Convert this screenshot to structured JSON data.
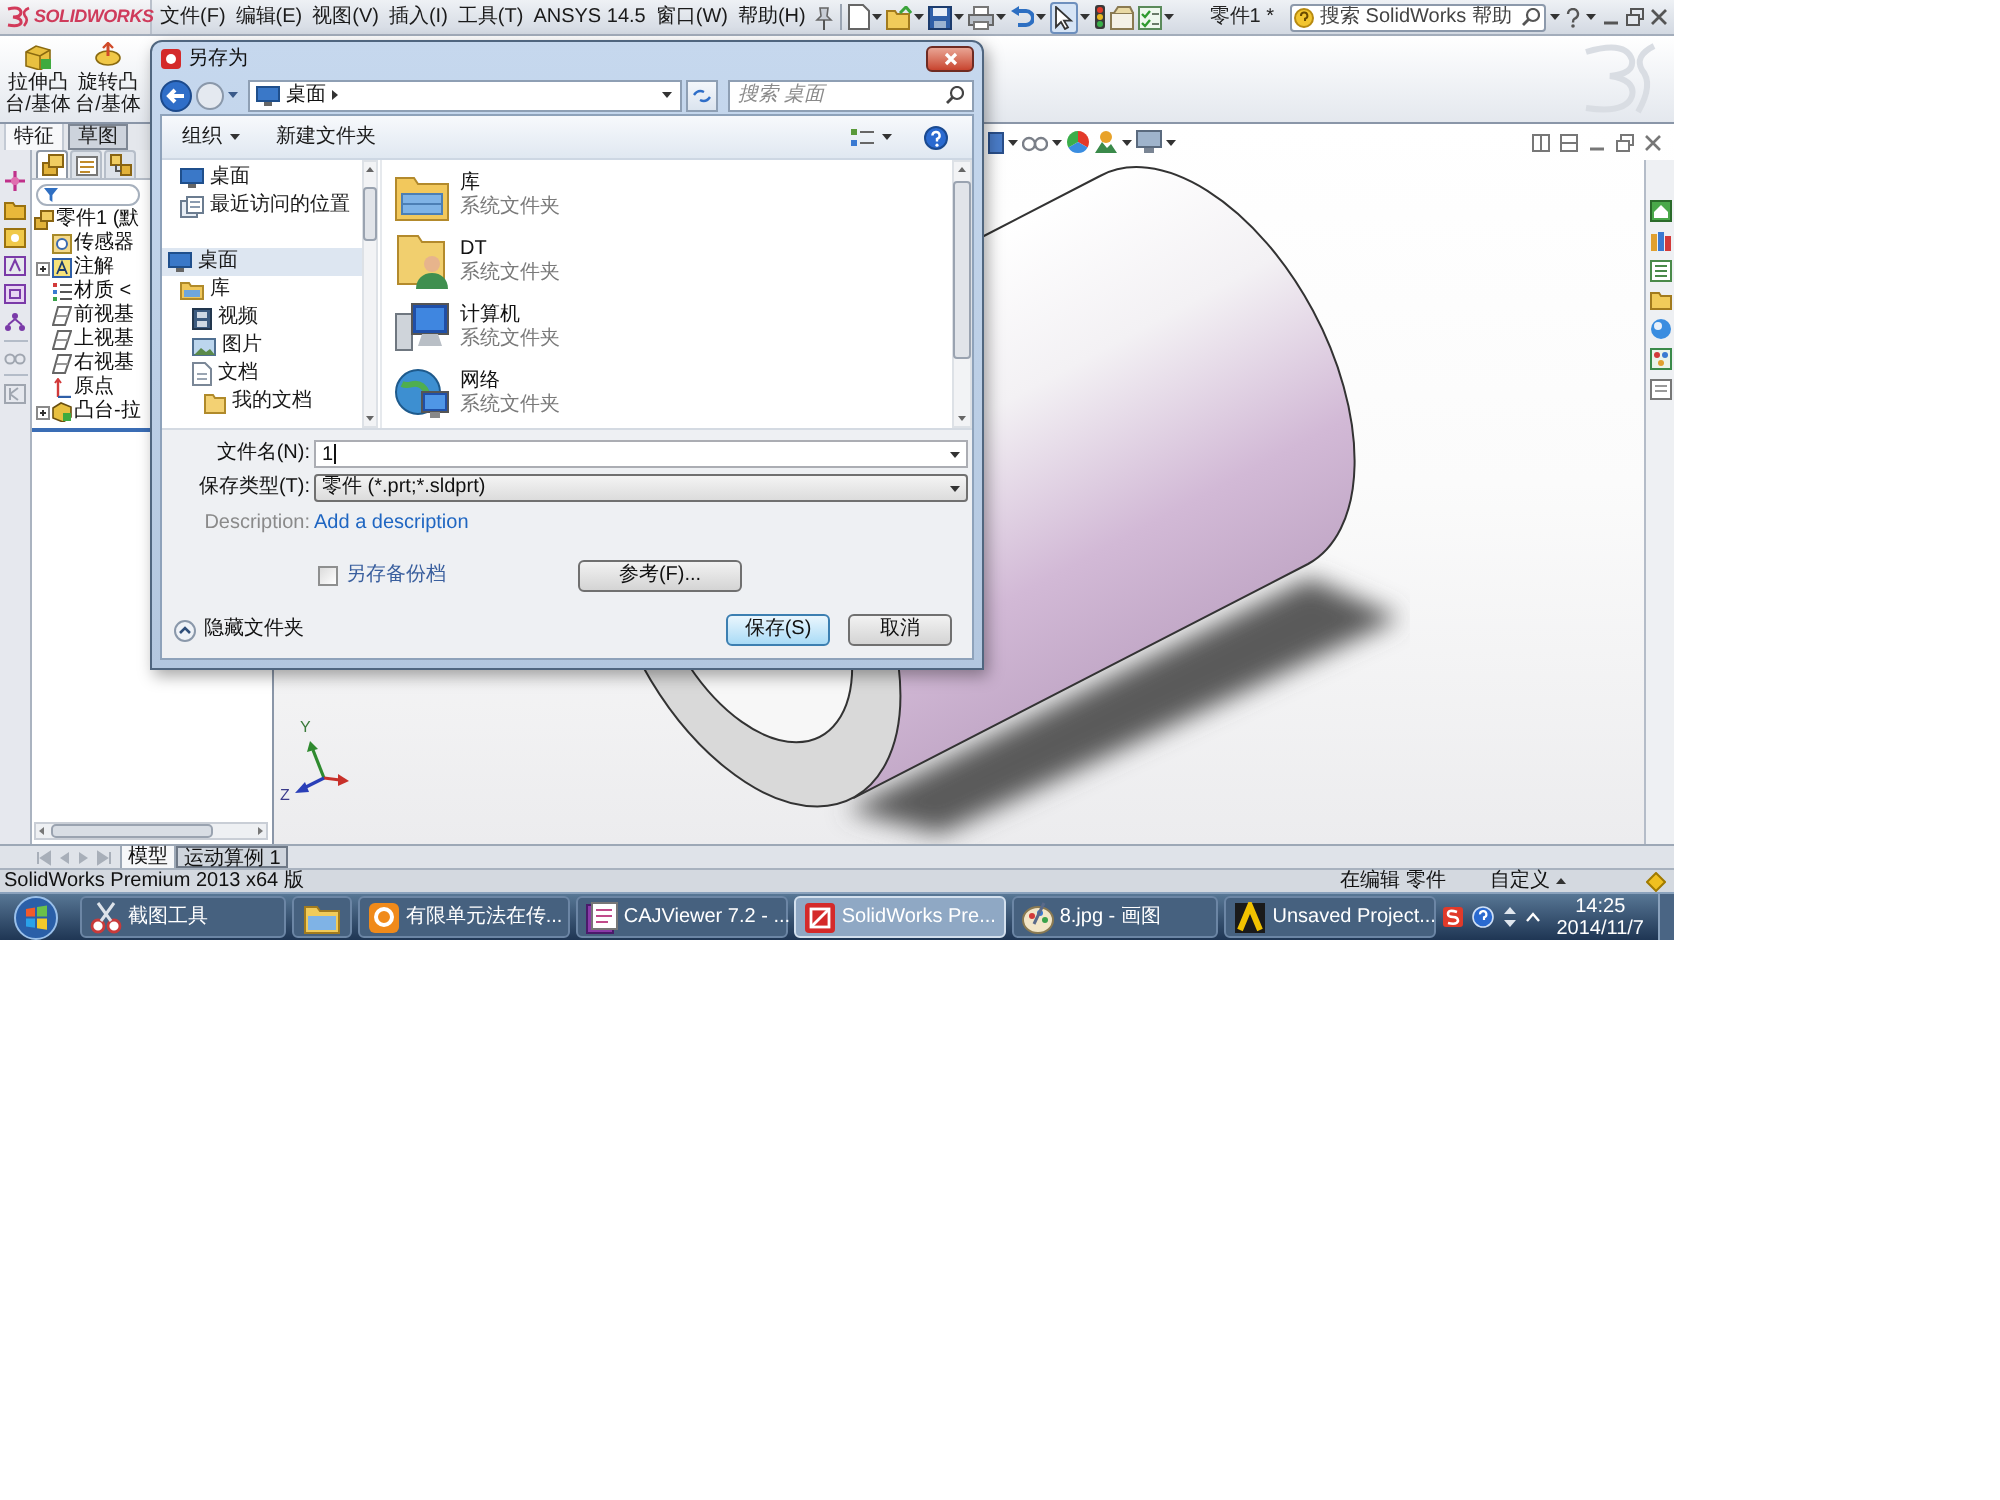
{
  "titlebar": {
    "logo": "SOLIDWORKS",
    "menu": [
      "文件(F)",
      "编辑(E)",
      "视图(V)",
      "插入(I)",
      "工具(T)",
      "ANSYS 14.5",
      "窗口(W)",
      "帮助(H)"
    ],
    "select_tool": {
      "pressed": true
    },
    "document_title": "零件1 *",
    "help_search": {
      "placeholder": "搜索 SolidWorks 帮助"
    }
  },
  "command_manager": {
    "buttons": [
      {
        "label": "拉伸凸台/基体",
        "kind": "extrude"
      },
      {
        "label": "旋转凸台/基体",
        "kind": "revolve"
      }
    ],
    "tabs": [
      {
        "label": "特征",
        "selected": true
      },
      {
        "label": "草图",
        "selected": false
      }
    ]
  },
  "feature_manager": {
    "panel_tabs": [
      {
        "kind": "tree",
        "selected": true
      },
      {
        "kind": "properties",
        "selected": false
      },
      {
        "kind": "configurations",
        "selected": false
      }
    ],
    "tree": [
      {
        "label": "零件1 (默",
        "kind": "part",
        "collapsed": false,
        "children": [
          {
            "label": "传感器",
            "kind": "sensors",
            "collapsed": false
          },
          {
            "label": "注解",
            "kind": "annotations",
            "collapsed": true
          },
          {
            "label": "材质 <",
            "kind": "material",
            "collapsed": false
          },
          {
            "label": "前视基",
            "kind": "plane",
            "collapsed": false
          },
          {
            "label": "上视基",
            "kind": "plane",
            "collapsed": false
          },
          {
            "label": "右视基",
            "kind": "plane",
            "collapsed": false
          },
          {
            "label": "原点",
            "kind": "origin",
            "collapsed": false
          },
          {
            "label": "凸台-拉",
            "kind": "feature",
            "collapsed": true
          }
        ]
      }
    ]
  },
  "graphics": {
    "triad": {
      "y_label": "Y",
      "z_label": "Z"
    }
  },
  "dialog": {
    "title": "另存为",
    "address": {
      "path": [
        "桌面"
      ]
    },
    "search": {
      "placeholder": "搜索 桌面"
    },
    "toolbar": {
      "organize": "组织",
      "new_folder": "新建文件夹"
    },
    "nav": {
      "favorites": [
        {
          "label": "桌面",
          "kind": "desktop",
          "selected": false
        },
        {
          "label": "最近访问的位置",
          "kind": "recent",
          "selected": false
        }
      ],
      "tree": [
        {
          "label": "桌面",
          "kind": "desktop",
          "selected": true,
          "children": [
            {
              "label": "库",
              "kind": "library",
              "selected": false,
              "children": [
                {
                  "label": "视频",
                  "kind": "video",
                  "selected": false
                },
                {
                  "label": "图片",
                  "kind": "pictures",
                  "selected": false
                },
                {
                  "label": "文档",
                  "kind": "documents",
                  "selected": false,
                  "children": [
                    {
                      "label": "我的文档",
                      "kind": "folder",
                      "selected": false
                    }
                  ]
                }
              ]
            }
          ]
        }
      ]
    },
    "files": [
      {
        "name": "库",
        "type": "系统文件夹",
        "kind": "library"
      },
      {
        "name": "DT",
        "type": "系统文件夹",
        "kind": "user"
      },
      {
        "name": "计算机",
        "type": "系统文件夹",
        "kind": "computer"
      },
      {
        "name": "网络",
        "type": "系统文件夹",
        "kind": "network"
      }
    ],
    "file_name": {
      "label": "文件名(N):",
      "value": "1"
    },
    "save_type": {
      "label": "保存类型(T):",
      "value": "零件 (*.prt;*.sldprt)"
    },
    "description": {
      "label": "Description:",
      "link": "Add a description"
    },
    "backup": {
      "label": "另存备份档",
      "checked": false
    },
    "reference_button": "参考(F)...",
    "hide_folders": "隐藏文件夹",
    "buttons": [
      {
        "label": "保存(S)",
        "default": true
      },
      {
        "label": "取消",
        "default": false
      }
    ]
  },
  "model_tabs": [
    {
      "label": "模型",
      "selected": true
    },
    {
      "label": "运动算例 1",
      "selected": false
    }
  ],
  "status_bar": {
    "product": "SolidWorks Premium 2013 x64 版",
    "mode": "在编辑 零件",
    "units": "自定义"
  },
  "taskbar": {
    "buttons": [
      {
        "label": "截图工具",
        "kind": "snipping",
        "selected": false
      },
      {
        "kind": "explorer",
        "selected": false
      },
      {
        "label": "有限单元法在传...",
        "kind": "pdf",
        "selected": false
      },
      {
        "label": "CAJViewer 7.2 - ...",
        "kind": "caj",
        "selected": false
      },
      {
        "label": "SolidWorks Pre...",
        "kind": "solidworks",
        "selected": true
      },
      {
        "label": "8.jpg - 画图",
        "kind": "paint",
        "selected": false
      },
      {
        "label": "Unsaved Project...",
        "kind": "ansys",
        "selected": false
      }
    ],
    "clock": {
      "time": "14:25",
      "date": "2014/11/7"
    }
  }
}
